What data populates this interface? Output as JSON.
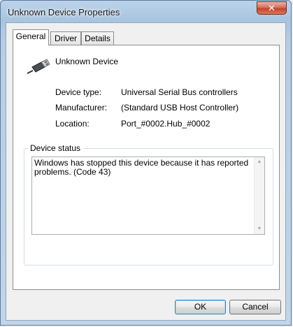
{
  "window": {
    "title": "Unknown Device Properties",
    "close_glyph": "✕"
  },
  "tabs": [
    {
      "label": "General",
      "active": true
    },
    {
      "label": "Driver",
      "active": false
    },
    {
      "label": "Details",
      "active": false
    }
  ],
  "device": {
    "icon": "usb-plug-icon",
    "name": "Unknown Device"
  },
  "properties": [
    {
      "label": "Device type:",
      "value": "Universal Serial Bus controllers"
    },
    {
      "label": "Manufacturer:",
      "value": "(Standard USB Host Controller)"
    },
    {
      "label": "Location:",
      "value": "Port_#0002.Hub_#0002"
    }
  ],
  "status": {
    "group_label": "Device status",
    "text": "Windows has stopped this device because it has reported problems. (Code 43)"
  },
  "buttons": {
    "ok": "OK",
    "cancel": "Cancel"
  },
  "colors": {
    "accent_border": "#3c7fb1",
    "frame": "#a9c4df"
  }
}
